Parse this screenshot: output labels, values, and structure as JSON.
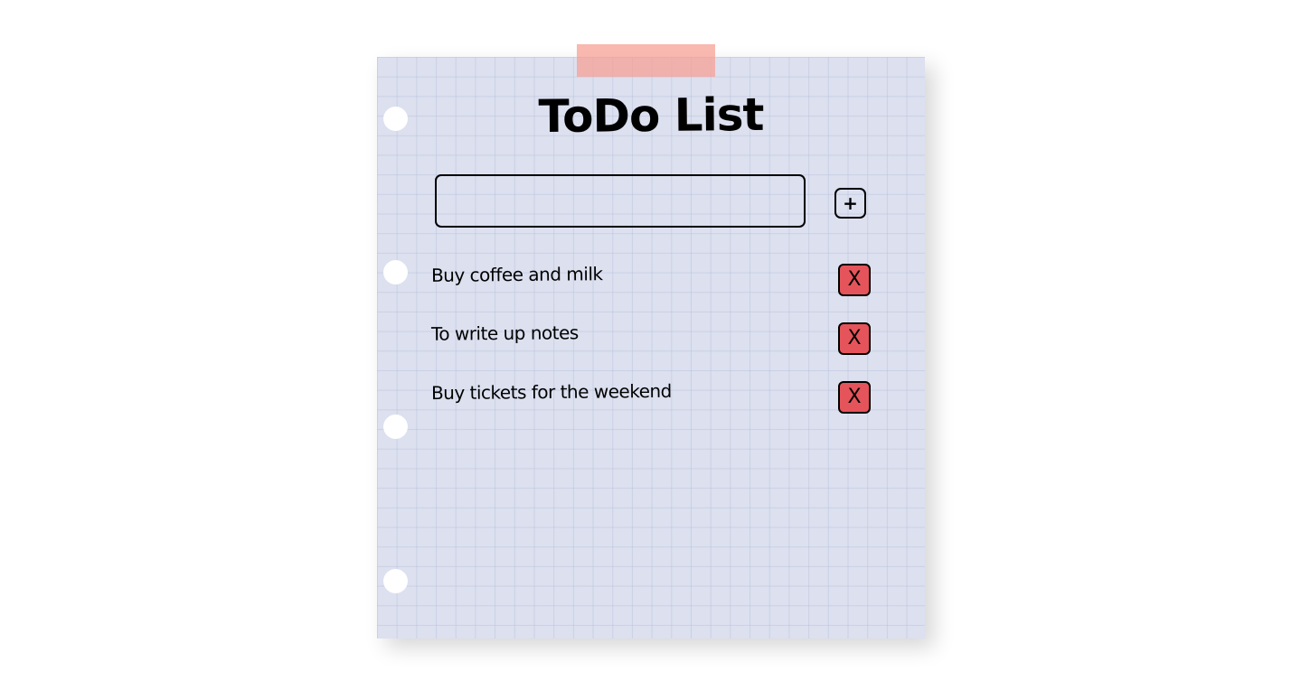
{
  "app": {
    "title": "ToDo List"
  },
  "input": {
    "value": "",
    "placeholder": ""
  },
  "add_button": {
    "label": "+"
  },
  "todos": [
    {
      "text": "Buy coffee and milk",
      "delete_label": "X"
    },
    {
      "text": "To write up notes",
      "delete_label": "X"
    },
    {
      "text": "Buy tickets for the weekend",
      "delete_label": "X"
    }
  ],
  "colors": {
    "page_background": "#ffffff",
    "paper": "#dce0ef",
    "tape": "#f7a096",
    "delete_button": "#e5545a",
    "ink": "#000000"
  }
}
